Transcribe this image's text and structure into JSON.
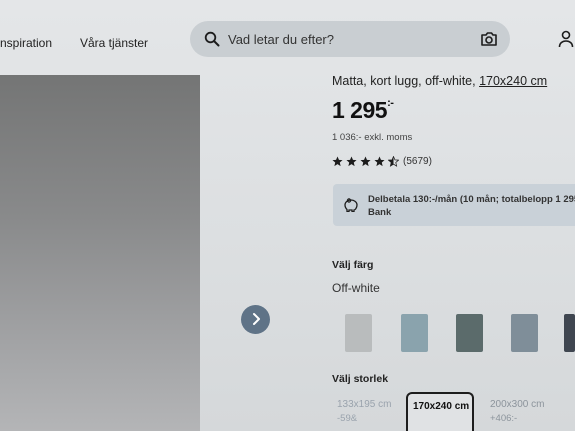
{
  "nav": {
    "inspiration": "nspiration",
    "services": "Våra tjänster"
  },
  "search": {
    "placeholder": "Vad letar du efter?"
  },
  "product": {
    "title_text": "Matta, kort lugg, off-white, ",
    "title_size": "170x240 cm",
    "price_main": "1 295",
    "price_dec": ":-",
    "price_ex_vat": "1 036:- exkl. moms",
    "rating": 4.5,
    "review_count": "(5679)"
  },
  "finance": {
    "line1": "Delbetala 130:-/mån (10 mån; totalbelopp 1 295",
    "line2": "Bank"
  },
  "color": {
    "heading": "Välj färg",
    "selected": "Off-white",
    "swatches": [
      "#b9bcbd",
      "#8aa3ad",
      "#5b6b6b",
      "#7f8e99",
      "#3f4650"
    ]
  },
  "size": {
    "heading": "Välj storlek",
    "options": [
      {
        "label": "133x195 cm",
        "sub": "-59&"
      },
      {
        "label": "170x240 cm",
        "sub": ""
      },
      {
        "label": "200x300 cm",
        "sub": "+406:-"
      }
    ]
  }
}
